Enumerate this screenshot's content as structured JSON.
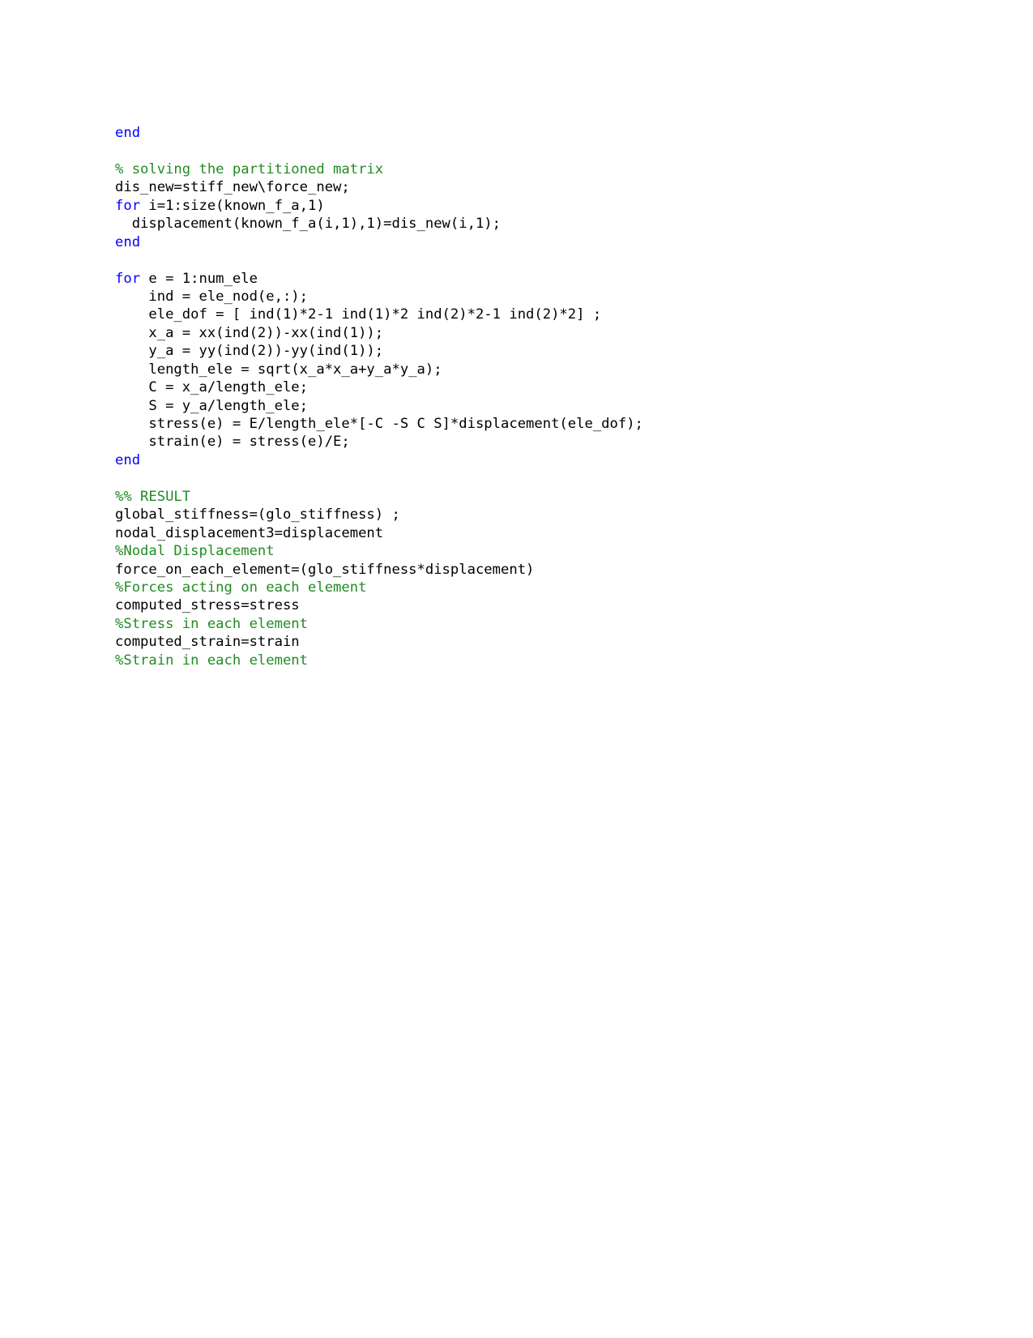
{
  "document": {
    "type": "code-listing",
    "language": "MATLAB",
    "background_color": "#ffffff",
    "colors": {
      "keyword": "#0000ff",
      "comment": "#228b22",
      "code": "#000000"
    }
  },
  "code": {
    "lines": [
      {
        "id": "line-1",
        "kind": "keyword",
        "text": "end"
      },
      {
        "id": "line-2",
        "kind": "blank",
        "text": ""
      },
      {
        "id": "line-3",
        "kind": "comment",
        "text": "% solving the partitioned matrix"
      },
      {
        "id": "line-4",
        "kind": "code",
        "text": "dis_new=stiff_new\\force_new;"
      },
      {
        "id": "line-5",
        "kind": "mixed",
        "keyword": "for",
        "text": " i=1:size(known_f_a,1)"
      },
      {
        "id": "line-6",
        "kind": "code",
        "text": "  displacement(known_f_a(i,1),1)=dis_new(i,1);"
      },
      {
        "id": "line-7",
        "kind": "keyword",
        "text": "end"
      },
      {
        "id": "line-8",
        "kind": "blank",
        "text": ""
      },
      {
        "id": "line-9",
        "kind": "mixed",
        "keyword": "for",
        "text": " e = 1:num_ele"
      },
      {
        "id": "line-10",
        "kind": "code",
        "text": "    ind = ele_nod(e,:);"
      },
      {
        "id": "line-11",
        "kind": "code",
        "text": "    ele_dof = [ ind(1)*2-1 ind(1)*2 ind(2)*2-1 ind(2)*2] ;"
      },
      {
        "id": "line-12",
        "kind": "code",
        "text": "    x_a = xx(ind(2))-xx(ind(1));"
      },
      {
        "id": "line-13",
        "kind": "code",
        "text": "    y_a = yy(ind(2))-yy(ind(1));"
      },
      {
        "id": "line-14",
        "kind": "code",
        "text": "    length_ele = sqrt(x_a*x_a+y_a*y_a);"
      },
      {
        "id": "line-15",
        "kind": "code",
        "text": "    C = x_a/length_ele;"
      },
      {
        "id": "line-16",
        "kind": "code",
        "text": "    S = y_a/length_ele;"
      },
      {
        "id": "line-17",
        "kind": "code",
        "text": "    stress(e) = E/length_ele*[-C -S C S]*displacement(ele_dof);"
      },
      {
        "id": "line-18",
        "kind": "code",
        "text": "    strain(e) = stress(e)/E;"
      },
      {
        "id": "line-19",
        "kind": "keyword",
        "text": "end"
      },
      {
        "id": "line-20",
        "kind": "blank",
        "text": ""
      },
      {
        "id": "line-21",
        "kind": "comment",
        "text": "%% RESULT"
      },
      {
        "id": "line-22",
        "kind": "code",
        "text": "global_stiffness=(glo_stiffness) ;"
      },
      {
        "id": "line-23",
        "kind": "code",
        "text": "nodal_displacement3=displacement"
      },
      {
        "id": "line-24",
        "kind": "comment",
        "text": "%Nodal Displacement"
      },
      {
        "id": "line-25",
        "kind": "code",
        "text": "force_on_each_element=(glo_stiffness*displacement)"
      },
      {
        "id": "line-26",
        "kind": "comment",
        "text": "%Forces acting on each element"
      },
      {
        "id": "line-27",
        "kind": "code",
        "text": "computed_stress=stress"
      },
      {
        "id": "line-28",
        "kind": "comment",
        "text": "%Stress in each element"
      },
      {
        "id": "line-29",
        "kind": "code",
        "text": "computed_strain=strain"
      },
      {
        "id": "line-30",
        "kind": "comment",
        "text": "%Strain in each element"
      }
    ]
  }
}
